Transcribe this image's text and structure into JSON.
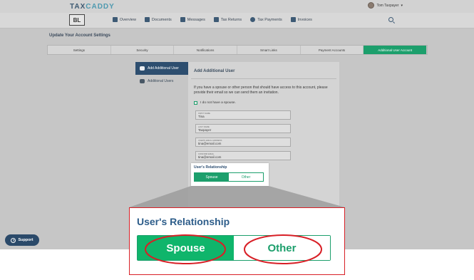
{
  "header": {
    "logo_text": "TAXCADDY",
    "brand_badge": "BL",
    "user_name": "Tom Taxpayer",
    "user_chevron": "▾"
  },
  "nav": {
    "items": [
      {
        "label": "Overview",
        "icon": "home-icon"
      },
      {
        "label": "Documents",
        "icon": "documents-icon"
      },
      {
        "label": "Messages",
        "icon": "messages-icon"
      },
      {
        "label": "Tax Returns",
        "icon": "tax-returns-icon"
      },
      {
        "label": "Tax Payments",
        "icon": "tax-payments-icon"
      },
      {
        "label": "Invoices",
        "icon": "invoices-icon"
      }
    ],
    "search_icon": "search-icon"
  },
  "page": {
    "title": "Update Your Account Settings",
    "tabs": [
      {
        "label": "Settings"
      },
      {
        "label": "Security"
      },
      {
        "label": "Notifications"
      },
      {
        "label": "Smart Links"
      },
      {
        "label": "Payment Accounts"
      },
      {
        "label": "Additional User Account",
        "active": true
      }
    ]
  },
  "sidebar": {
    "items": [
      {
        "label": "Add Additional User",
        "icon": "add-user-icon",
        "active": true
      },
      {
        "label": "Additional Users",
        "icon": "users-icon"
      }
    ]
  },
  "panel": {
    "title": "Add Additional User",
    "intro": "If you have a spouse or other person that should have access to this account, please provide their email so we can send them an invitation.",
    "no_spouse_label": "I do not have a spouse.",
    "fields": [
      {
        "label": "First Name",
        "value": "Tina"
      },
      {
        "label": "Last Name",
        "value": "Taxpayer"
      },
      {
        "label": "User's Email Address",
        "value": "tina@email.com"
      },
      {
        "label": "Confirm Email",
        "value": "tina@email.com"
      }
    ],
    "relationship": {
      "title": "User's Relationship",
      "options": [
        "Spouse",
        "Other"
      ],
      "selected": "Spouse"
    }
  },
  "support": {
    "label": "Support",
    "icon": "question-icon"
  },
  "zoom": {
    "title": "User's Relationship",
    "options": [
      "Spouse",
      "Other"
    ],
    "selected": "Spouse"
  },
  "colors": {
    "accent_green": "#1c9f6c",
    "selected_green": "#0fb56b",
    "navy": "#2d4e6f",
    "highlight_red": "#d81f26"
  }
}
